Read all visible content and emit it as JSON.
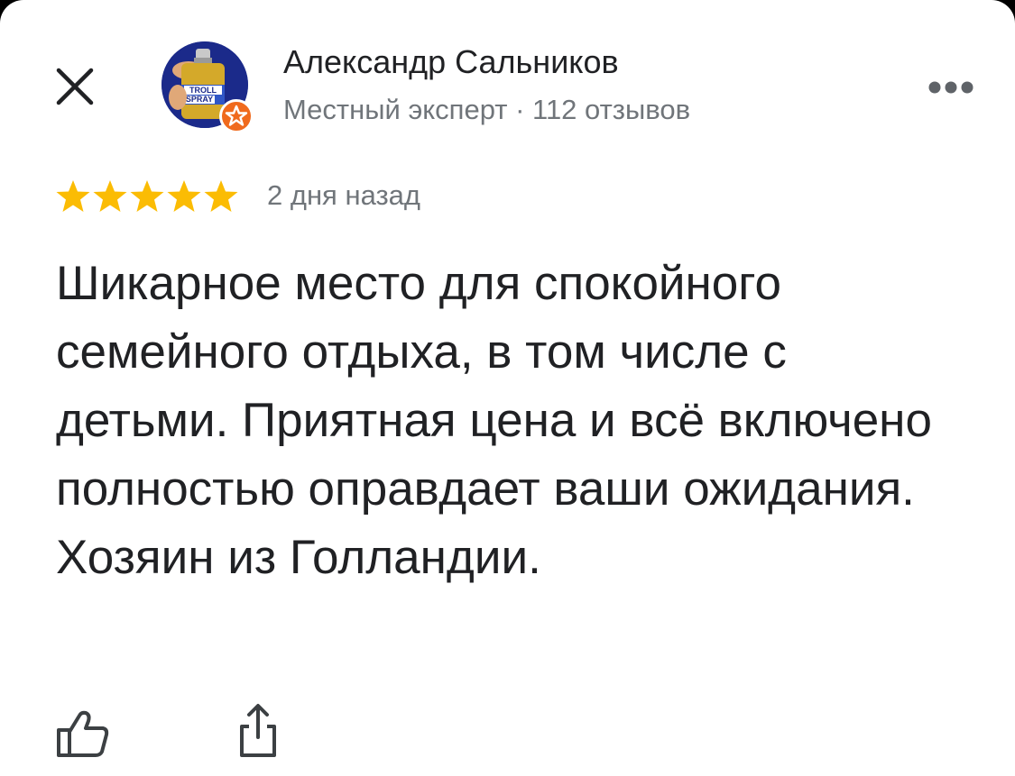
{
  "author": {
    "name": "Александр Сальников",
    "meta": "Местный эксперт · 112 отзывов",
    "avatar_text_line1": "TROLL",
    "avatar_text_line2": "SPRAY"
  },
  "review": {
    "rating": 5,
    "rating_max": 5,
    "date": "2 дня назад",
    "text": "Шикарное место для спокойного семейного отдыха, в том числе с детьми. Приятная цена и всё включено полностью оправдает ваши ожидания. Хозяин из Голландии."
  },
  "icons": {
    "close": "close-icon",
    "more": "more-icon",
    "star": "star-icon",
    "like": "thumbs-up-icon",
    "share": "share-icon",
    "expert_badge": "local-guide-badge-icon"
  },
  "colors": {
    "star": "#fbbc04",
    "text_primary": "#202124",
    "text_secondary": "#70757a",
    "badge": "#f06a1d"
  }
}
